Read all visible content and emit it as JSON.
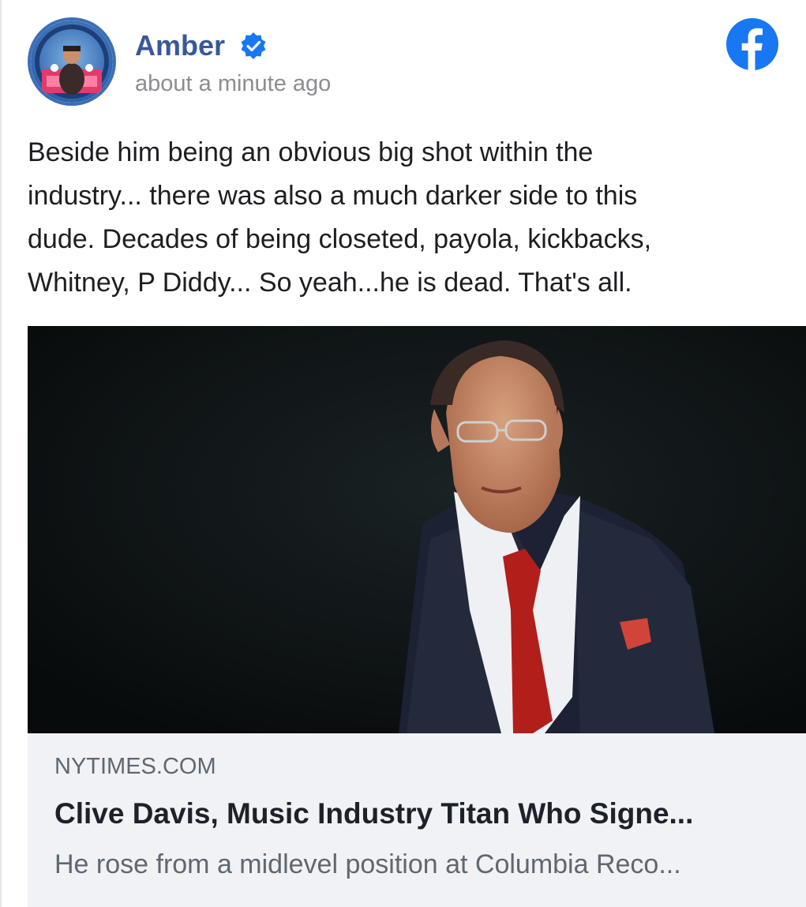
{
  "post": {
    "author": "Amber",
    "timestamp": "about a minute ago",
    "verified_icon": "verified-badge-icon",
    "platform_icon": "facebook-logo-icon",
    "text_lines": [
      "Beside him being an obvious big shot within the",
      "industry... there was also a much darker side to this",
      "dude. Decades of being closeted, payola, kickbacks,",
      "Whitney, P Diddy... So yeah...he is dead. That's all."
    ]
  },
  "link_preview": {
    "domain": "NYTIMES.COM",
    "title": "Clive Davis, Music Industry Titan Who Signe...",
    "description": "He rose from a midlevel position at Columbia Reco..."
  },
  "colors": {
    "author_name": "#385898",
    "verified_badge": "#1877f2",
    "facebook_brand": "#1877f2",
    "card_background": "#f0f2f5",
    "secondary_text": "#606770"
  }
}
